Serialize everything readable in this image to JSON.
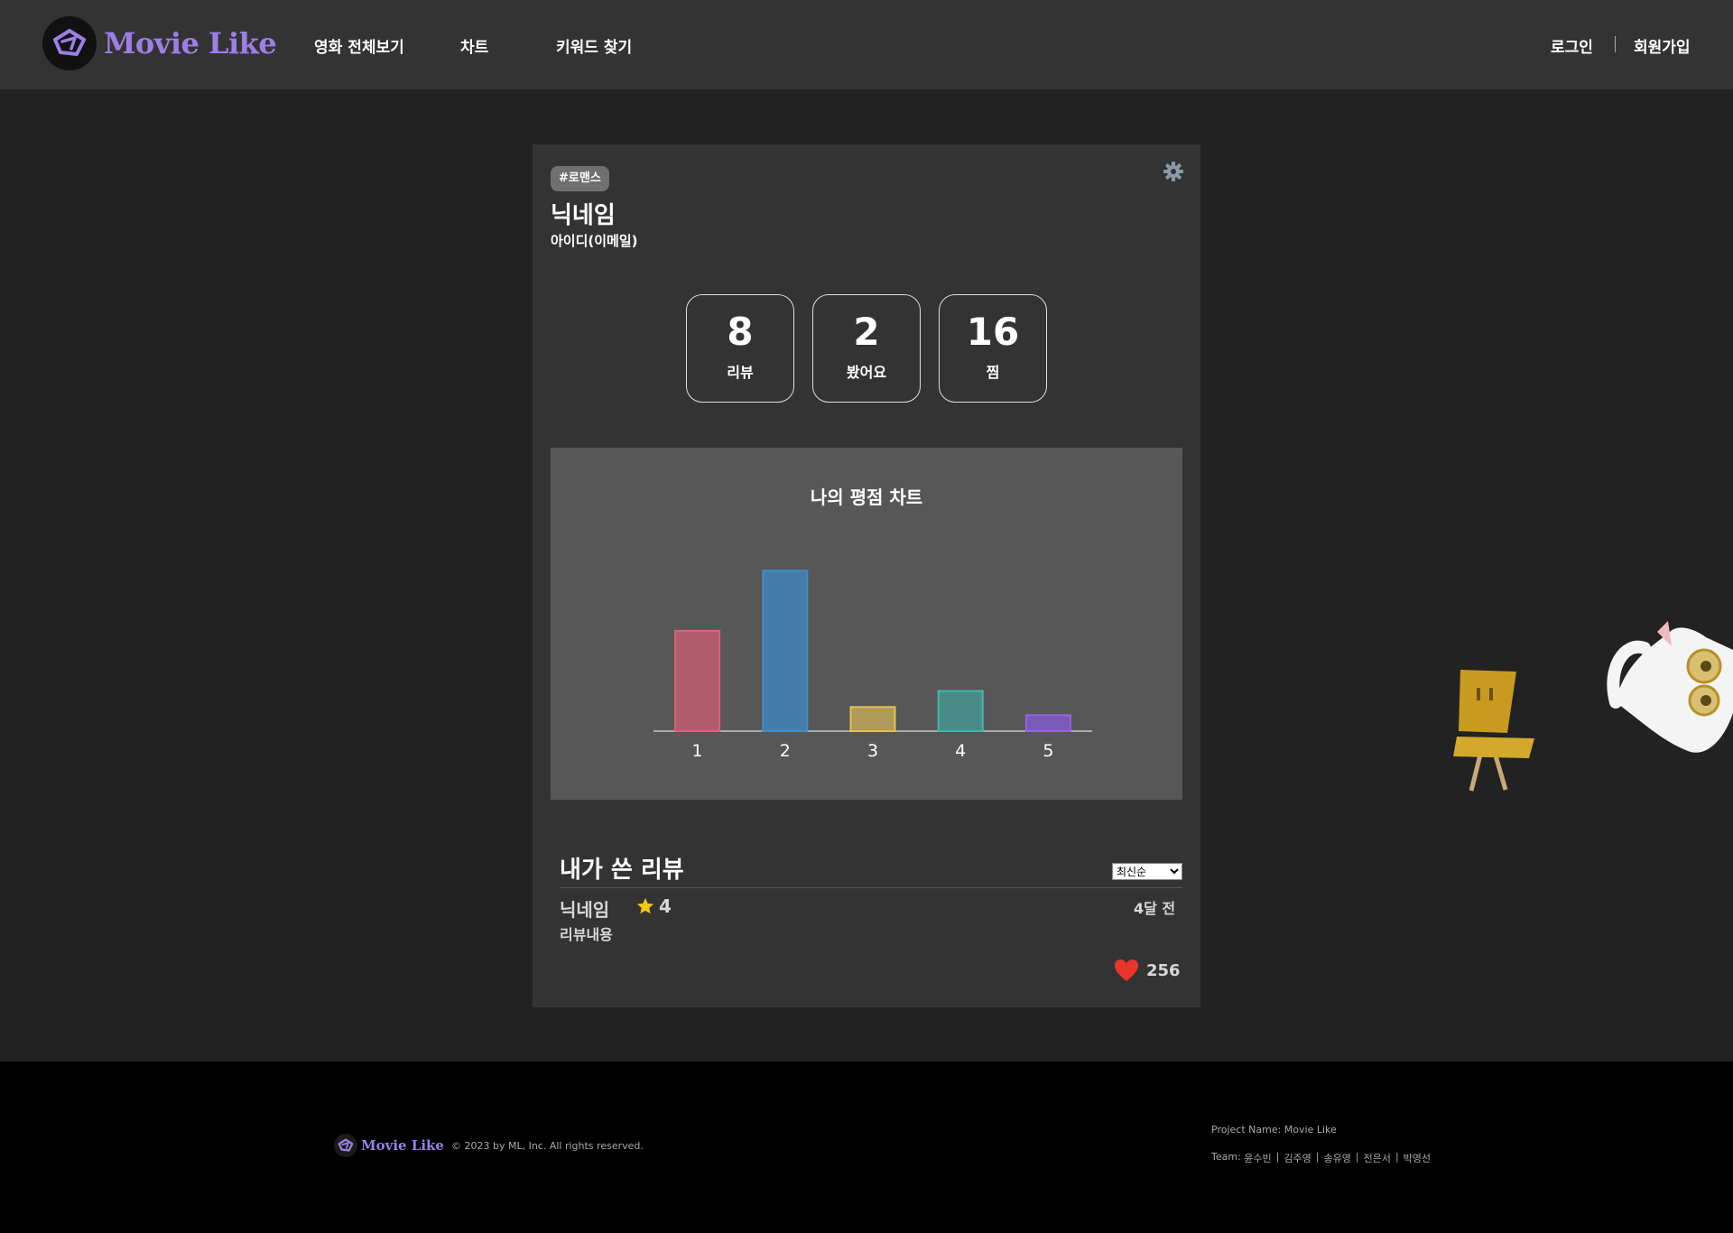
{
  "header": {
    "logo_text": "Movie Like",
    "nav": [
      "영화 전체보기",
      "차트",
      "키워드 찾기"
    ],
    "login": "로그인",
    "signup": "회원가입"
  },
  "profile": {
    "tag": "#로맨스",
    "nickname": "닉네임",
    "user_id": "아이디(이메일)",
    "stats": [
      {
        "value": "8",
        "label": "리뷰"
      },
      {
        "value": "2",
        "label": "봤어요"
      },
      {
        "value": "16",
        "label": "찜"
      }
    ]
  },
  "chart_data": {
    "type": "bar",
    "title": "나의 평점 차트",
    "categories": [
      "1",
      "2",
      "3",
      "4",
      "5"
    ],
    "values": [
      5,
      8,
      1.2,
      2,
      0.8
    ],
    "ylim": [
      0,
      9
    ],
    "colors": [
      "#b05c6e",
      "#457da8",
      "#b09a5a",
      "#4a8a88",
      "#7a5ab8"
    ],
    "border_colors": [
      "#e0607a",
      "#3a8fd0",
      "#e8c050",
      "#40b8b0",
      "#9a60e0"
    ],
    "grid": false,
    "legend": "none"
  },
  "reviews": {
    "title": "내가 쓴 리뷰",
    "sort_selected": "최신순",
    "items": [
      {
        "nickname": "닉네임",
        "rating": "4",
        "time": "4달 전",
        "content": "리뷰내용",
        "likes": "256"
      }
    ]
  },
  "footer": {
    "logo_text": "Movie Like",
    "copyright": "© 2023 by ML, Inc. All rights reserved.",
    "project": "Project Name: Movie Like",
    "team_label": "Team:",
    "team": [
      "윤수빈",
      "김주영",
      "송유영",
      "전은서",
      "박영선"
    ]
  }
}
